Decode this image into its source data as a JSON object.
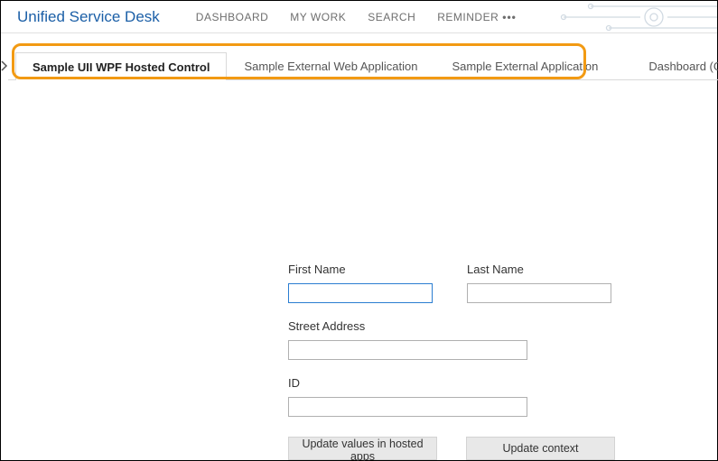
{
  "header": {
    "app_title": "Unified Service Desk",
    "nav": {
      "dashboard": "DASHBOARD",
      "my_work": "MY WORK",
      "search": "SEARCH",
      "reminder": "REMINDER"
    }
  },
  "tabs": {
    "t0": "Sample UII WPF Hosted Control",
    "t1": "Sample External Web Application",
    "t2": "Sample External Application",
    "t3": "Dashboard (Global)"
  },
  "form": {
    "first_name_label": "First Name",
    "first_name_value": "",
    "last_name_label": "Last Name",
    "last_name_value": "",
    "street_label": "Street Address",
    "street_value": "",
    "id_label": "ID",
    "id_value": ""
  },
  "buttons": {
    "update_hosted": "Update values in hosted apps",
    "update_context": "Update context"
  }
}
